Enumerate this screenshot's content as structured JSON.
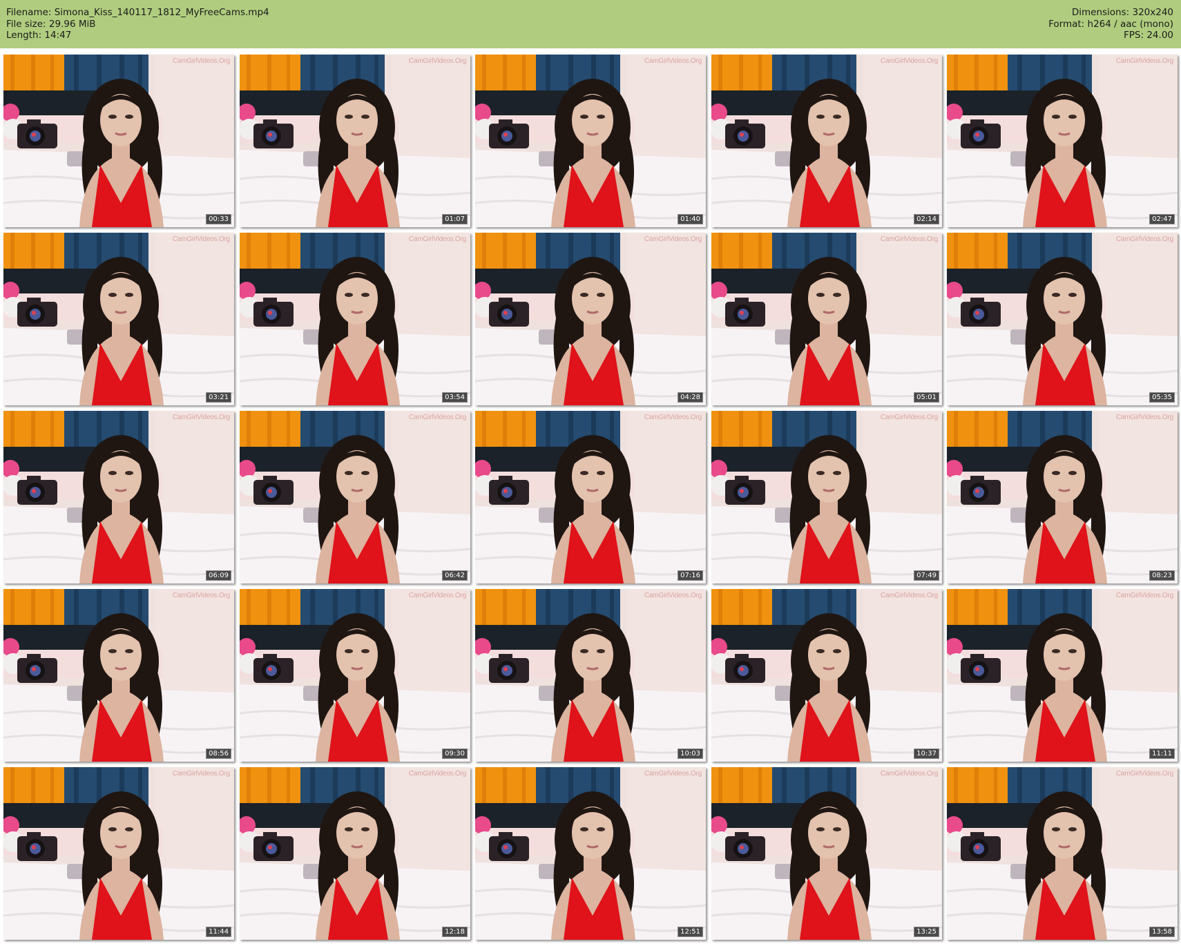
{
  "header": {
    "filename_label": "Filename: Simona_Kiss_140117_1812_MyFreeCams.mp4",
    "filesize_label": "File size: 29.96 MiB",
    "length_label": "Length: 14:47",
    "dimensions_label": "Dimensions: 320x240",
    "format_label": "Format: h264 / aac (mono)",
    "fps_label": "FPS: 24.00",
    "background_color": "#b0cd7f"
  },
  "watermark": "CamGirlVideos.Org",
  "thumbnails": [
    {
      "timestamp": "00:33"
    },
    {
      "timestamp": "01:07"
    },
    {
      "timestamp": "01:40"
    },
    {
      "timestamp": "02:14"
    },
    {
      "timestamp": "02:47"
    },
    {
      "timestamp": "03:21"
    },
    {
      "timestamp": "03:54"
    },
    {
      "timestamp": "04:28"
    },
    {
      "timestamp": "05:01"
    },
    {
      "timestamp": "05:35"
    },
    {
      "timestamp": "06:09"
    },
    {
      "timestamp": "06:42"
    },
    {
      "timestamp": "07:16"
    },
    {
      "timestamp": "07:49"
    },
    {
      "timestamp": "08:23"
    },
    {
      "timestamp": "08:56"
    },
    {
      "timestamp": "09:30"
    },
    {
      "timestamp": "10:03"
    },
    {
      "timestamp": "10:37"
    },
    {
      "timestamp": "11:11"
    },
    {
      "timestamp": "11:44"
    },
    {
      "timestamp": "12:18"
    },
    {
      "timestamp": "12:51"
    },
    {
      "timestamp": "13:25"
    },
    {
      "timestamp": "13:58"
    }
  ]
}
